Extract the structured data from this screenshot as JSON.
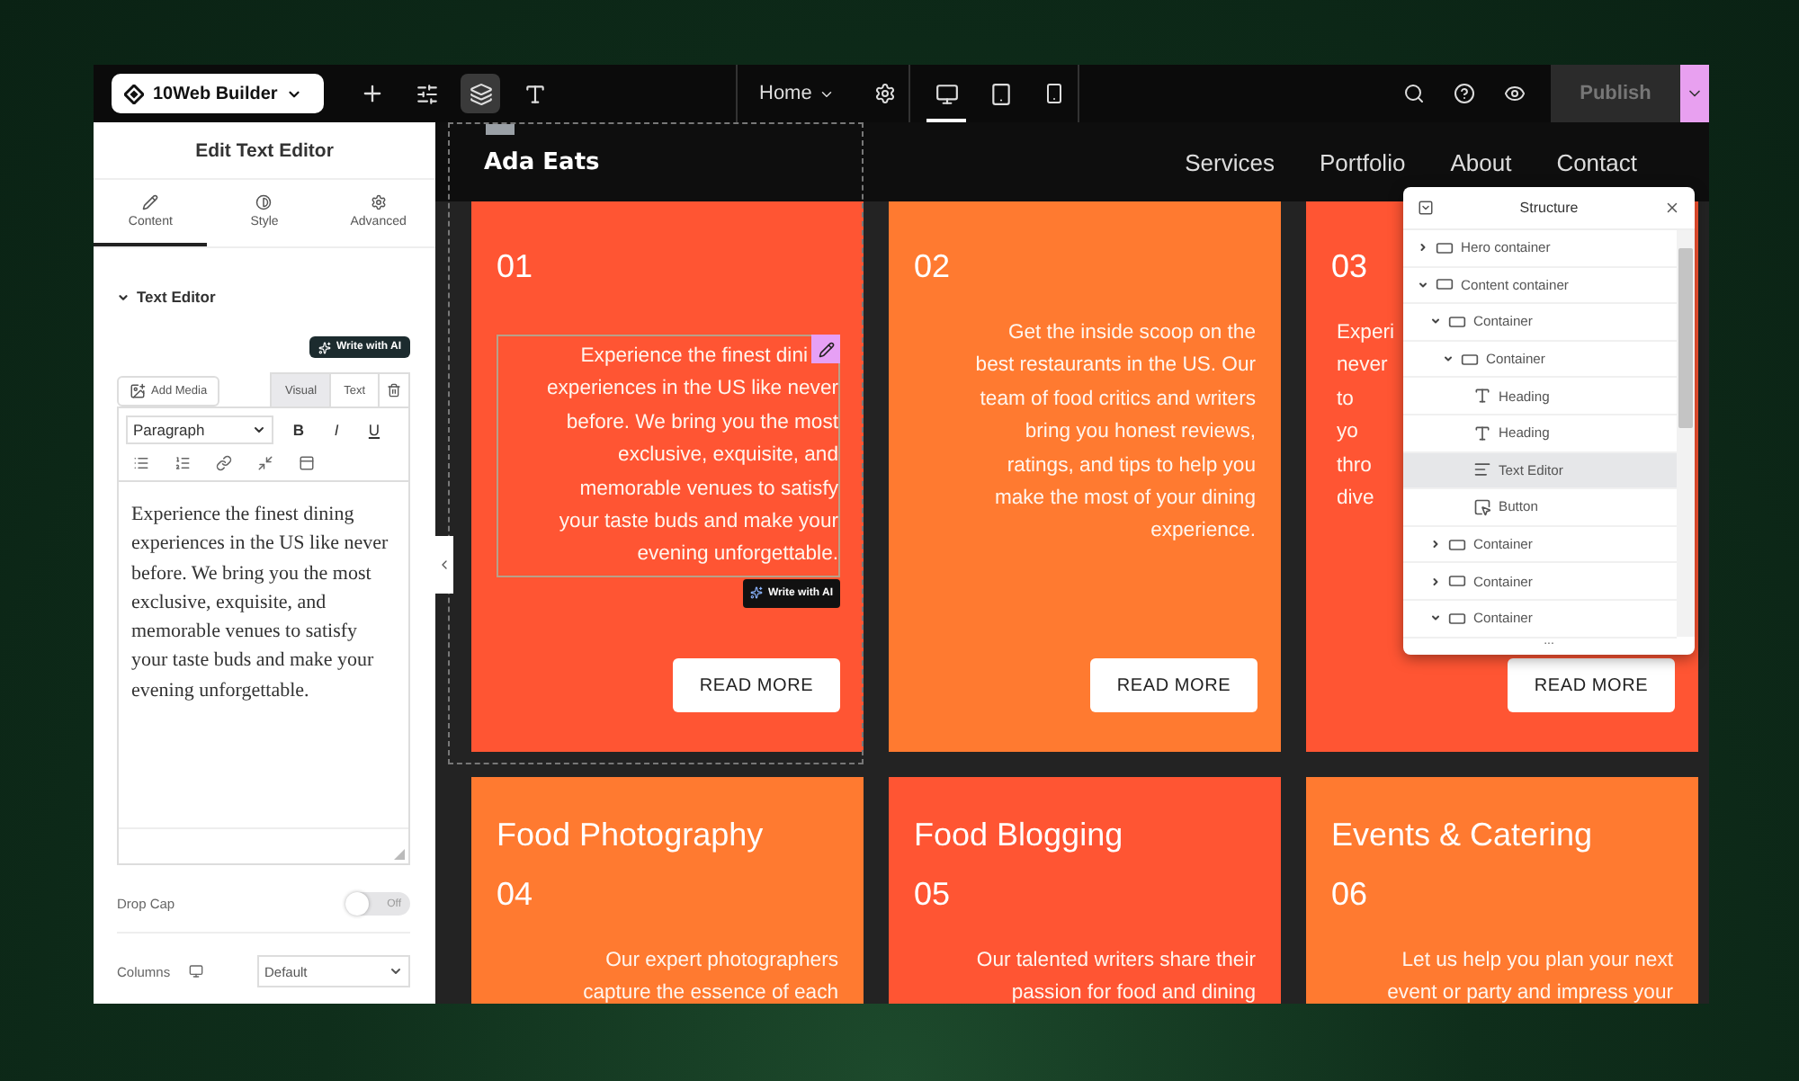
{
  "toolbar": {
    "brand": "10Web Builder",
    "page": "Home",
    "publish": {
      "label": "Publish",
      "disabled": true
    },
    "tools": [
      {
        "kind": "add",
        "selected": false
      },
      {
        "kind": "sliders",
        "selected": false
      },
      {
        "kind": "layers",
        "selected": true
      },
      {
        "kind": "fonts",
        "selected": false
      }
    ],
    "devices": [
      {
        "kind": "desktop",
        "selected": true
      },
      {
        "kind": "tablet",
        "selected": false
      },
      {
        "kind": "mobile",
        "selected": false
      }
    ]
  },
  "panel": {
    "title": "Edit Text Editor",
    "tabs": [
      {
        "label": "Content",
        "kind": "content",
        "selected": true
      },
      {
        "label": "Style",
        "kind": "style",
        "selected": false
      },
      {
        "label": "Advanced",
        "kind": "advanced",
        "selected": false
      }
    ],
    "section": "Text Editor",
    "ai_button": "Write with AI",
    "add_media": "Add Media",
    "editor_tabs": [
      {
        "label": "Visual",
        "selected": true
      },
      {
        "label": "Text",
        "selected": false
      }
    ],
    "format": "Paragraph",
    "format_buttons": [
      "B",
      "I",
      "U"
    ],
    "content": "Experience the finest dining experiences in the US like never before. We bring you the most exclusive, exquisite, and memorable venues to satisfy your taste buds and make your evening unforgettable.",
    "drop_cap": {
      "label": "Drop Cap",
      "on": false,
      "state": "Off"
    },
    "columns": {
      "label": "Columns",
      "value": "Default"
    }
  },
  "site": {
    "logo": "Ada Eats",
    "nav": [
      "Services",
      "Portfolio",
      "About",
      "Contact"
    ],
    "ai_badge": "Write with AI",
    "cards": [
      {
        "number": "01",
        "color": "#ff5533",
        "selected": true,
        "lines": [
          "Experience the finest dini",
          "experiences in the US like never",
          "before. We bring you the most",
          "exclusive, exquisite, and",
          "memorable venues to satisfy",
          "your taste buds and make your",
          "evening unforgettable."
        ],
        "button": "READ MORE"
      },
      {
        "number": "02",
        "color": "#ff7a30",
        "selected": false,
        "lines": [
          "Get the inside scoop on the",
          "best restaurants in the US. Our",
          "team of food critics and writers",
          "bring you honest reviews,",
          "ratings, and tips to help you",
          "make the most of your dining",
          "experience."
        ],
        "button": "READ MORE"
      },
      {
        "number": "03",
        "color": "#ff5533",
        "selected": false,
        "kind": "covered",
        "lines": [
          "Experi",
          "never",
          "to",
          "yo",
          "thro",
          "dive"
        ],
        "button": "READ MORE"
      },
      {
        "heading": "Food Photography",
        "number": "04",
        "color": "#ff7a30",
        "selected": false,
        "lines": [
          "Our expert photographers",
          "capture the essence of each"
        ]
      },
      {
        "heading": "Food Blogging",
        "number": "05",
        "color": "#ff5533",
        "selected": false,
        "lines": [
          "Our talented writers share their",
          "passion for food and dining"
        ]
      },
      {
        "heading": "Events & Catering",
        "number": "06",
        "color": "#ff7a30",
        "selected": false,
        "lines": [
          "Let us help you plan your next",
          "event or party and impress your"
        ]
      }
    ]
  },
  "structure": {
    "title": "Structure",
    "more": "...",
    "items": [
      {
        "label": "Hero container",
        "kind": "container",
        "expanded": false,
        "selected": false
      },
      {
        "label": "Content container",
        "kind": "container",
        "expanded": true,
        "selected": false,
        "children": [
          {
            "label": "Container",
            "kind": "container",
            "expanded": true,
            "selected": false,
            "children": [
              {
                "label": "Container",
                "kind": "container",
                "expanded": true,
                "selected": false,
                "children": [
                  {
                    "label": "Heading",
                    "kind": "heading",
                    "selected": false
                  },
                  {
                    "label": "Heading",
                    "kind": "heading",
                    "selected": false
                  },
                  {
                    "label": "Text Editor",
                    "kind": "text",
                    "selected": true
                  },
                  {
                    "label": "Button",
                    "kind": "button",
                    "selected": false
                  }
                ]
              }
            ]
          },
          {
            "label": "Container",
            "kind": "container",
            "expanded": false,
            "selected": false
          },
          {
            "label": "Container",
            "kind": "container",
            "expanded": false,
            "selected": false
          },
          {
            "label": "Container",
            "kind": "container",
            "expanded": true,
            "selected": false
          }
        ]
      }
    ]
  }
}
